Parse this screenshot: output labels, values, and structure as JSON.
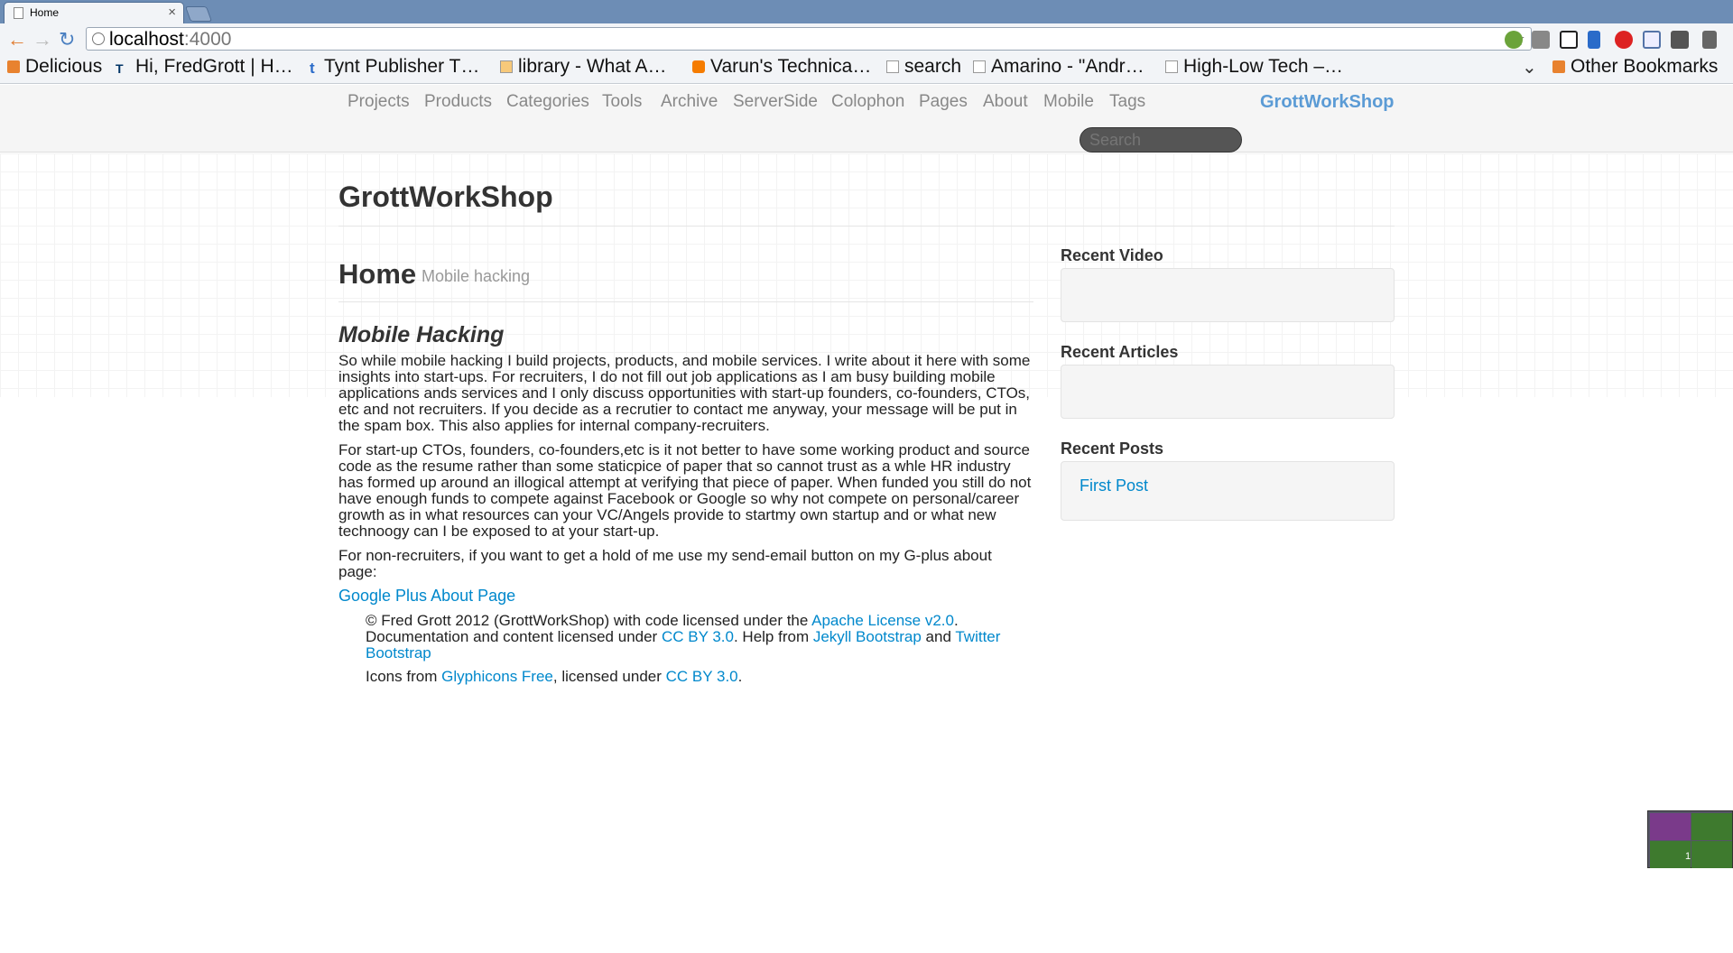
{
  "browser": {
    "tab_title": "Home",
    "tab_close": "×",
    "back": "←",
    "forward": "→",
    "reload": "↻",
    "url_host": "localhost",
    "url_port": ":4000",
    "star": "☆"
  },
  "bookmarks": [
    {
      "label": "Delicious",
      "icon": "folder-icon"
    },
    {
      "label": "Hi, FredGrott | H…",
      "icon": "site-icon"
    },
    {
      "label": "Tynt Publisher T…",
      "icon": "site-icon"
    },
    {
      "label": "library - What A…",
      "icon": "site-icon"
    },
    {
      "label": "Varun's Technica…",
      "icon": "blogger-icon"
    },
    {
      "label": "search",
      "icon": "page-icon"
    },
    {
      "label": "Amarino - \"Andr…",
      "icon": "page-icon"
    },
    {
      "label": "High-Low Tech –…",
      "icon": "page-icon"
    },
    {
      "label": "Other Bookmarks",
      "icon": "folder-icon"
    }
  ],
  "site": {
    "nav": [
      "Projects",
      "Products",
      "Categories",
      "Tools",
      "Archive",
      "ServerSide",
      "Colophon",
      "Pages",
      "About",
      "Mobile",
      "Tags"
    ],
    "brand": "GrottWorkShop",
    "search_placeholder": "Search",
    "title": "GrottWorkShop"
  },
  "page": {
    "heading": "Home",
    "subheading": "Mobile hacking",
    "post_title": "Mobile Hacking",
    "para1": "So while mobile hacking I build projects, products, and mobile services. I write about it here with some insights into start-ups. For recruiters, I do not fill out job applications as I am busy building mobile applications ands services and I only discuss opportunities with start-up founders, co-founders, CTOs, etc and not recruiters. If you decide as a recrutier to contact me anyway, your message will be put in the spam box. This also applies for internal company-recruiters.",
    "para2": "For start-up CTOs, founders, co-founders,etc is it not better to have some working product and source code as the resume rather than some staticpice of paper that so cannot trust as a whle HR industry has formed up around an illogical attempt at verifying that piece of paper. When funded you still do not have enough funds to compete against Facebook or Google so why not compete on personal/career growth as in what resources can your VC/Angels provide to startmy own startup and or what new technoogy can I be exposed to at your start-up.",
    "para3": "For non-recruiters, if you want to get a hold of me use my send-email button on my G-plus about page:",
    "gplus_link": "Google Plus About Page"
  },
  "footer": {
    "line1_a": "© Fred Grott 2012 (GrottWorkShop) with code licensed under the ",
    "apache": "Apache License v2.0",
    "line1_b": ". Documentation and content licensed under ",
    "ccby1": "CC BY 3.0",
    "line1_c": ". Help from ",
    "jekyll": "Jekyll Bootstrap",
    "line1_d": " and ",
    "twitter": "Twitter Bootstrap",
    "line2_a": "Icons from ",
    "glyphicons": "Glyphicons Free",
    "line2_b": ", licensed under ",
    "ccby2": "CC BY 3.0",
    "line2_c": "."
  },
  "sidebar": {
    "recent_video": "Recent Video",
    "recent_articles": "Recent Articles",
    "recent_posts": "Recent Posts",
    "first_post": "First Post"
  },
  "workspace_number": "1",
  "colors": {
    "link": "#0088cc",
    "brand": "#5b9bd5",
    "tabstrip": "#6d8db5"
  }
}
